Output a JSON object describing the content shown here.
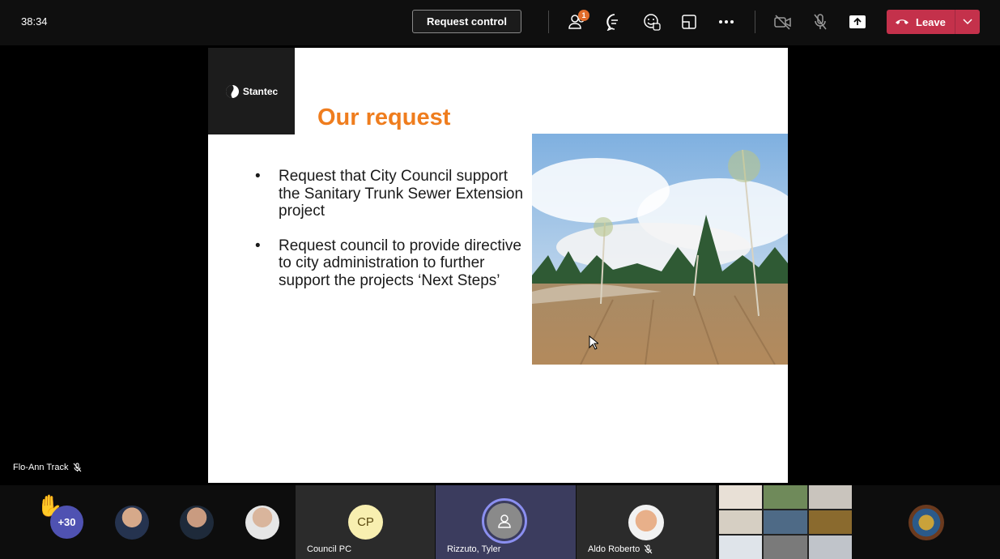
{
  "meeting": {
    "timer": "38:34",
    "request_control_label": "Request control",
    "participants_badge": "1",
    "leave_label": "Leave"
  },
  "toolbar_icons": [
    "people-icon",
    "chat-icon",
    "reactions-icon",
    "rooms-icon",
    "more-icon",
    "camera-off-icon",
    "mic-off-icon",
    "share-icon",
    "phone-icon",
    "chevron-down-icon"
  ],
  "presenter": {
    "name": "Flo-Ann Track"
  },
  "slide": {
    "logo_text": "Stantec",
    "title": "Our request",
    "bullets": [
      "Request that City Council support the Sanitary Trunk Sewer Extension project",
      "Request council to provide directive to city administration to further support the projects ‘Next Steps’"
    ],
    "bullet_glyph": "•",
    "title_color": "#ef7d1e"
  },
  "strip": {
    "more_count": "+30",
    "tiles": [
      {
        "initials": "CP",
        "name": "Council PC"
      },
      {
        "name": "Rizzuto, Tyler"
      },
      {
        "name": "Aldo Roberto"
      }
    ]
  },
  "colors": {
    "leave": "#c4314b",
    "active_tile": "#3b3c5e",
    "count_badge": "#4f52b2"
  }
}
